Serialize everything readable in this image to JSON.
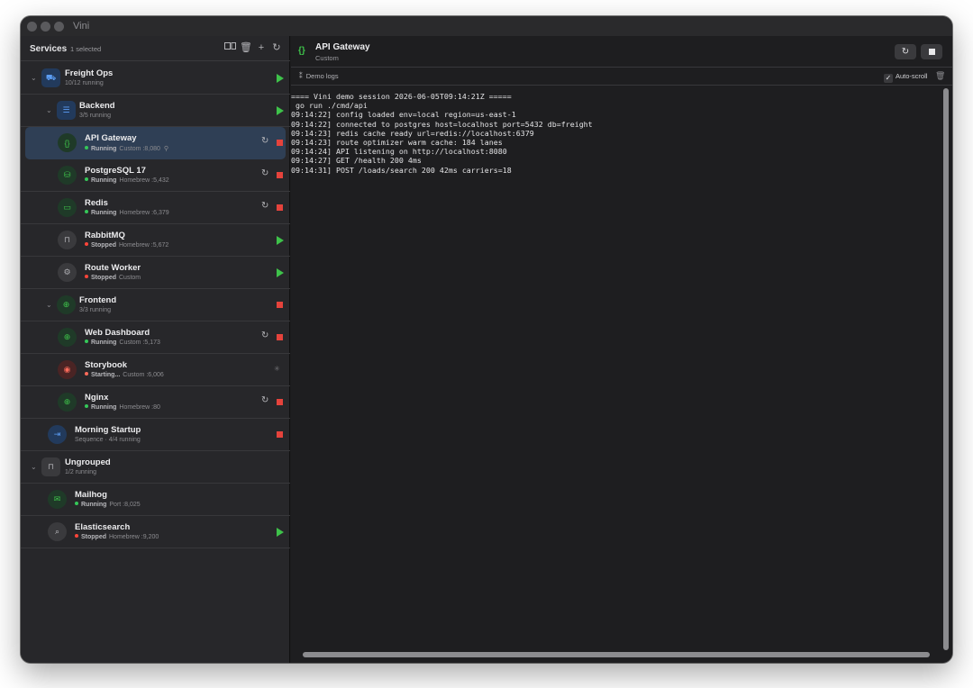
{
  "window": {
    "title": "Vini"
  },
  "sidebar": {
    "title": "Services",
    "selection_count": "1 selected",
    "rows": [
      {
        "kind": "group",
        "name": "Freight Ops",
        "status_line": "10/12 running",
        "icon": "truck-icon",
        "action": "play"
      },
      {
        "kind": "subgroup",
        "name": "Backend",
        "status_line": "3/5 running",
        "icon": "server-icon",
        "action": "play"
      },
      {
        "kind": "service",
        "name": "API Gateway",
        "status": "Running",
        "detail": "Custom :8,080",
        "pinned": true,
        "icon": "braces-icon",
        "action": "restart-stop",
        "selected": true
      },
      {
        "kind": "service",
        "name": "PostgreSQL 17",
        "status": "Running",
        "detail": "Homebrew :5,432",
        "icon": "database-icon",
        "action": "restart-stop"
      },
      {
        "kind": "service",
        "name": "Redis",
        "status": "Running",
        "detail": "Homebrew :6,379",
        "icon": "cache-icon",
        "action": "restart-stop"
      },
      {
        "kind": "service",
        "name": "RabbitMQ",
        "status": "Stopped",
        "detail": "Homebrew :5,672",
        "icon": "inbox-icon",
        "action": "play"
      },
      {
        "kind": "service",
        "name": "Route Worker",
        "status": "Stopped",
        "detail": "Custom",
        "icon": "gears-icon",
        "action": "play"
      },
      {
        "kind": "subgroup",
        "name": "Frontend",
        "status_line": "3/3 running",
        "icon": "globe-icon",
        "action": "stop"
      },
      {
        "kind": "service",
        "name": "Web Dashboard",
        "status": "Running",
        "detail": "Custom :5,173",
        "icon": "globe-icon",
        "action": "restart-stop"
      },
      {
        "kind": "service",
        "name": "Storybook",
        "status": "Starting...",
        "detail": "Custom :6,006",
        "icon": "palette-icon",
        "action": "spinner"
      },
      {
        "kind": "service",
        "name": "Nginx",
        "status": "Running",
        "detail": "Homebrew :80",
        "icon": "globe-icon",
        "action": "restart-stop"
      },
      {
        "kind": "sequence",
        "name": "Morning Startup",
        "status_line": "Sequence · 4/4 running",
        "icon": "sequence-icon",
        "action": "stop"
      },
      {
        "kind": "group",
        "name": "Ungrouped",
        "status_line": "1/2 running",
        "icon": "tray-icon",
        "action": "none"
      },
      {
        "kind": "service",
        "name": "Mailhog",
        "status": "Running",
        "detail": "Port :8,025",
        "icon": "mail-icon",
        "action": "none"
      },
      {
        "kind": "service",
        "name": "Elasticsearch",
        "status": "Stopped",
        "detail": "Homebrew :9,200",
        "icon": "search-icon",
        "action": "play"
      }
    ]
  },
  "main": {
    "service_name": "API Gateway",
    "service_kind": "Custom",
    "log_source": "Demo logs",
    "autoscroll_label": "Auto-scroll",
    "autoscroll_checked": true,
    "log_lines": [
      "==== Vini demo session 2026-06-05T09:14:21Z =====",
      " go run ./cmd/api",
      "09:14:22] config loaded env=local region=us-east-1",
      "09:14:22] connected to postgres host=localhost port=5432 db=freight",
      "09:14:23] redis cache ready url=redis://localhost:6379",
      "09:14:23] route optimizer warm cache: 184 lanes",
      "09:14:24] API listening on http://localhost:8080",
      "09:14:27] GET /health 200 4ms",
      "09:14:31] POST /loads/search 200 42ms carriers=18"
    ]
  },
  "colors": {
    "running": "#35c759",
    "stopped": "#ff453a",
    "starting": "#ff6b5b",
    "selection": "#2f3f55",
    "play": "#3ec24a",
    "stop": "#e5433c"
  }
}
